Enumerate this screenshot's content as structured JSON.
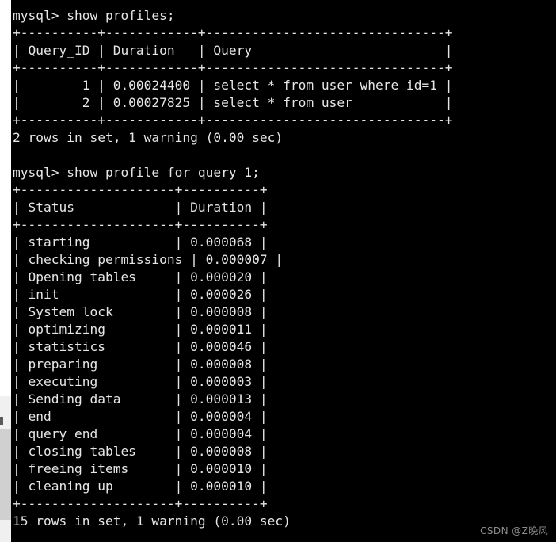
{
  "terminal": {
    "background_color": "#000000",
    "text_color": "#e6e6e6",
    "watermark": "CSDN @Z晚风",
    "lines": [
      "mysql> show profiles;",
      "+----------+------------+-------------------------------+",
      "| Query_ID | Duration   | Query                         |",
      "+----------+------------+-------------------------------+",
      "|        1 | 0.00024400 | select * from user where id=1 |",
      "|        2 | 0.00027825 | select * from user            |",
      "+----------+------------+-------------------------------+",
      "2 rows in set, 1 warning (0.00 sec)",
      "",
      "mysql> show profile for query 1;",
      "+--------------------+----------+",
      "| Status             | Duration |",
      "+--------------------+----------+",
      "| starting           | 0.000068 |",
      "| checking permissions | 0.000007 |",
      "| Opening tables     | 0.000020 |",
      "| init               | 0.000026 |",
      "| System lock        | 0.000008 |",
      "| optimizing         | 0.000011 |",
      "| statistics         | 0.000046 |",
      "| preparing          | 0.000008 |",
      "| executing          | 0.000003 |",
      "| Sending data       | 0.000013 |",
      "| end                | 0.000004 |",
      "| query end          | 0.000004 |",
      "| closing tables     | 0.000008 |",
      "| freeing items      | 0.000010 |",
      "| cleaning up        | 0.000010 |",
      "+--------------------+----------+",
      "15 rows in set, 1 warning (0.00 sec)"
    ],
    "commands": [
      "show profiles;",
      "show profile for query 1;"
    ],
    "prompt": "mysql>",
    "profiles_table": {
      "headers": [
        "Query_ID",
        "Duration",
        "Query"
      ],
      "rows": [
        [
          "1",
          "0.00024400",
          "select * from user where id=1"
        ],
        [
          "2",
          "0.00027825",
          "select * from user"
        ]
      ],
      "footer": "2 rows in set, 1 warning (0.00 sec)"
    },
    "profile_table": {
      "headers": [
        "Status",
        "Duration"
      ],
      "rows": [
        [
          "starting",
          "0.000068"
        ],
        [
          "checking permissions",
          "0.000007"
        ],
        [
          "Opening tables",
          "0.000020"
        ],
        [
          "init",
          "0.000026"
        ],
        [
          "System lock",
          "0.000008"
        ],
        [
          "optimizing",
          "0.000011"
        ],
        [
          "statistics",
          "0.000046"
        ],
        [
          "preparing",
          "0.000008"
        ],
        [
          "executing",
          "0.000003"
        ],
        [
          "Sending data",
          "0.000013"
        ],
        [
          "end",
          "0.000004"
        ],
        [
          "query end",
          "0.000004"
        ],
        [
          "closing tables",
          "0.000008"
        ],
        [
          "freeing items",
          "0.000010"
        ],
        [
          "cleaning up",
          "0.000010"
        ]
      ],
      "footer": "15 rows in set, 1 warning (0.00 sec)"
    }
  }
}
